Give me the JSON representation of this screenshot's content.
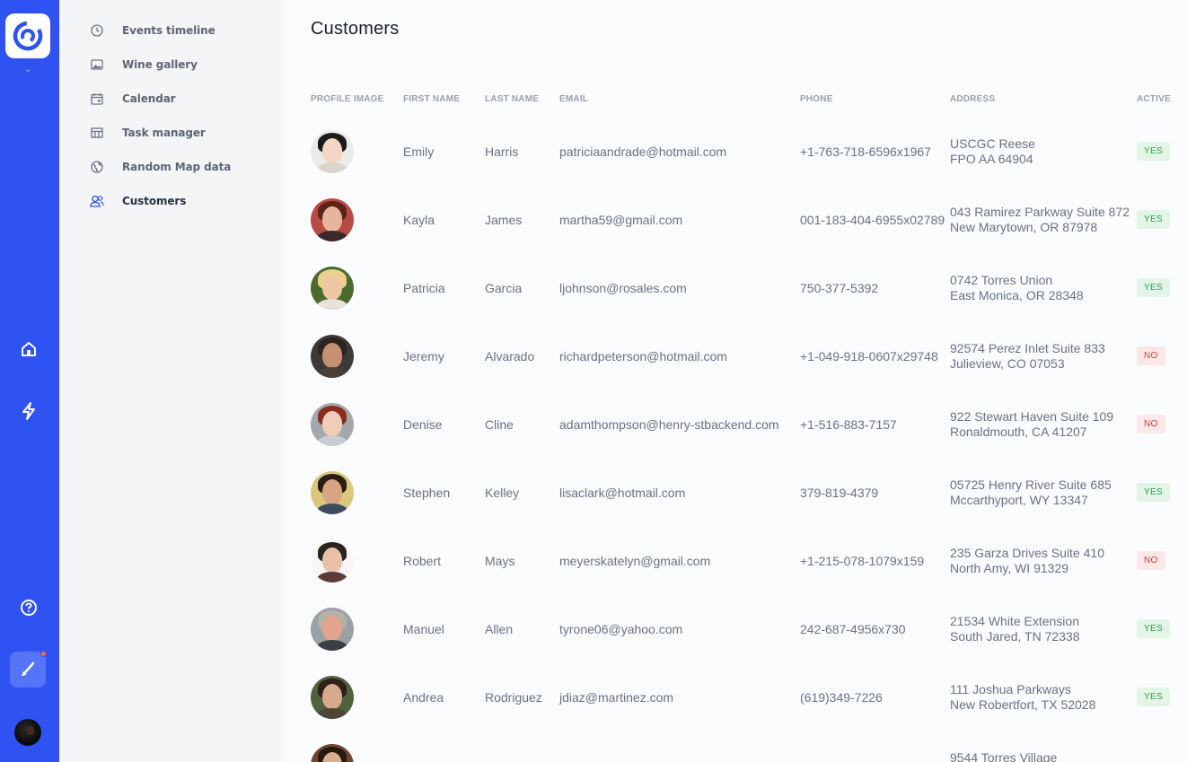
{
  "rail": {
    "icons": [
      "app-logo-icon",
      "chevron-down-icon",
      "home-icon",
      "bolt-icon",
      "help-icon",
      "brush-icon",
      "user-avatar"
    ],
    "accent_color": "#2f52f2"
  },
  "nav": {
    "items": [
      {
        "label": "Events timeline",
        "icon": "clock-icon"
      },
      {
        "label": "Wine gallery",
        "icon": "image-icon"
      },
      {
        "label": "Calendar",
        "icon": "calendar-icon"
      },
      {
        "label": "Task manager",
        "icon": "table-icon"
      },
      {
        "label": "Random Map data",
        "icon": "globe-icon"
      },
      {
        "label": "Customers",
        "icon": "users-icon"
      }
    ],
    "active": "Customers"
  },
  "main": {
    "title": "Customers",
    "columns": [
      "PROFILE IMAGE",
      "FIRST NAME",
      "LAST NAME",
      "EMAIL",
      "PHONE",
      "ADDRESS",
      "ACTIVE"
    ],
    "rows": [
      {
        "first": "Emily",
        "last": "Harris",
        "email": "patriciaandrade@hotmail.com",
        "phone": "+1-763-718-6596x1967",
        "addr1": "USCGC Reese",
        "addr2": "FPO AA 64904",
        "active": "YES"
      },
      {
        "first": "Kayla",
        "last": "James",
        "email": "martha59@gmail.com",
        "phone": "001-183-404-6955x02789",
        "addr1": "043 Ramirez Parkway Suite 872",
        "addr2": "New Marytown, OR 87978",
        "active": "YES"
      },
      {
        "first": "Patricia",
        "last": "Garcia",
        "email": "ljohnson@rosales.com",
        "phone": "750-377-5392",
        "addr1": "0742 Torres Union",
        "addr2": "East Monica, OR 28348",
        "active": "YES"
      },
      {
        "first": "Jeremy",
        "last": "Alvarado",
        "email": "richardpeterson@hotmail.com",
        "phone": "+1-049-918-0607x29748",
        "addr1": "92574 Perez Inlet Suite 833",
        "addr2": "Julieview, CO 07053",
        "active": "NO"
      },
      {
        "first": "Denise",
        "last": "Cline",
        "email": "adamthompson@henry-stbackend.com",
        "phone": "+1-516-883-7157",
        "addr1": "922 Stewart Haven Suite 109",
        "addr2": "Ronaldmouth, CA 41207",
        "active": "NO"
      },
      {
        "first": "Stephen",
        "last": "Kelley",
        "email": "lisaclark@hotmail.com",
        "phone": "379-819-4379",
        "addr1": "05725 Henry River Suite 685",
        "addr2": "Mccarthyport, WY 13347",
        "active": "YES"
      },
      {
        "first": "Robert",
        "last": "Mays",
        "email": "meyerskatelyn@gmail.com",
        "phone": "+1-215-078-1079x159",
        "addr1": "235 Garza Drives Suite 410",
        "addr2": "North Amy, WI 91329",
        "active": "NO"
      },
      {
        "first": "Manuel",
        "last": "Allen",
        "email": "tyrone06@yahoo.com",
        "phone": "242-687-4956x730",
        "addr1": "21534 White Extension",
        "addr2": "South Jared, TN 72338",
        "active": "YES"
      },
      {
        "first": "Andrea",
        "last": "Rodriguez",
        "email": "jdiaz@martinez.com",
        "phone": "(619)349-7226",
        "addr1": "111 Joshua Parkways",
        "addr2": "New Robertfort, TX 52028",
        "active": "YES"
      },
      {
        "first": "",
        "last": "",
        "email": "",
        "phone": "",
        "addr1": "9544 Torres Village",
        "addr2": "",
        "active": ""
      }
    ]
  },
  "colors": {
    "yes_bg": "#e3f5e7",
    "yes_fg": "#2e9a52",
    "no_bg": "#fde7e7",
    "no_fg": "#d33b3b"
  }
}
